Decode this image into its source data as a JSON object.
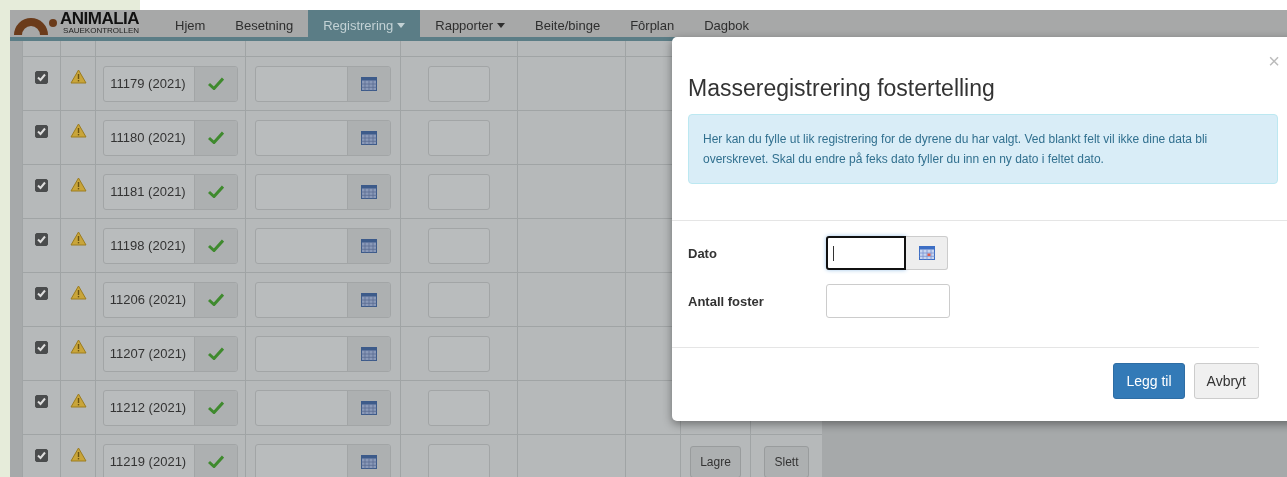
{
  "logo": {
    "name": "ANIMALIA",
    "subtitle": "SAUEKONTROLLEN"
  },
  "nav": [
    {
      "label": "Hjem",
      "selected": false,
      "dropdown": false
    },
    {
      "label": "Besetning",
      "selected": false,
      "dropdown": false
    },
    {
      "label": "Registrering",
      "selected": true,
      "dropdown": true
    },
    {
      "label": "Rapporter",
      "selected": false,
      "dropdown": true
    },
    {
      "label": "Beite/binge",
      "selected": false,
      "dropdown": false
    },
    {
      "label": "Fôrplan",
      "selected": false,
      "dropdown": false
    },
    {
      "label": "Dagbok",
      "selected": false,
      "dropdown": false
    }
  ],
  "rows": [
    {
      "checked": true,
      "warning": true,
      "id": "11179 (2021)",
      "verified": true
    },
    {
      "checked": true,
      "warning": true,
      "id": "11180 (2021)",
      "verified": true
    },
    {
      "checked": true,
      "warning": true,
      "id": "11181 (2021)",
      "verified": true
    },
    {
      "checked": true,
      "warning": true,
      "id": "11198 (2021)",
      "verified": true
    },
    {
      "checked": true,
      "warning": true,
      "id": "11206 (2021)",
      "verified": true
    },
    {
      "checked": true,
      "warning": true,
      "id": "11207 (2021)",
      "verified": true
    },
    {
      "checked": true,
      "warning": true,
      "id": "11212 (2021)",
      "verified": true
    },
    {
      "checked": true,
      "warning": true,
      "id": "11219 (2021)",
      "verified": true,
      "actions": [
        "Lagre",
        "Slett"
      ]
    }
  ],
  "modal": {
    "title": "Masseregistrering fostertelling",
    "close": "×",
    "info": "Her kan du fylle ut lik registrering for de dyrene du har valgt. Ved blankt felt vil ikke dine data bli overskrevet. Skal du endre på feks dato fyller du inn en ny dato i feltet dato.",
    "fields": [
      {
        "label": "Dato",
        "kind": "date",
        "focused": true
      },
      {
        "label": "Antall foster",
        "kind": "text",
        "focused": false
      }
    ],
    "buttons": [
      {
        "label": "Legg til",
        "primary": true
      },
      {
        "label": "Avbryt",
        "primary": false
      }
    ]
  }
}
